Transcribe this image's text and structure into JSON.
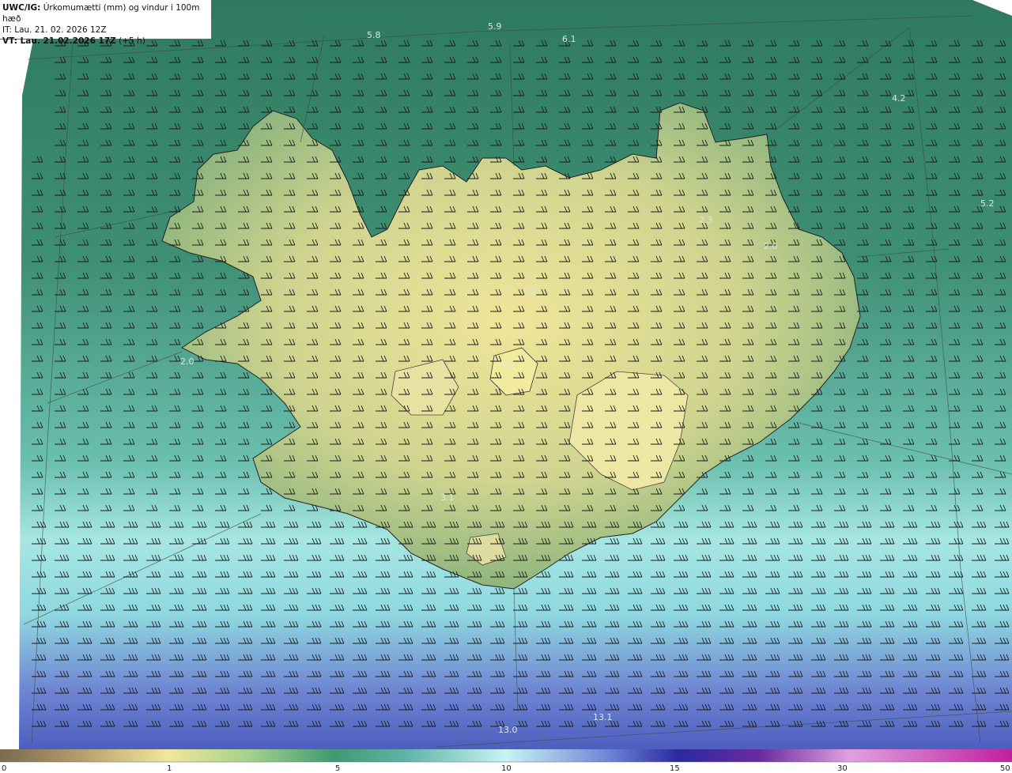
{
  "info": {
    "model": "UWC/IG:",
    "title": "Úrkomumætti (mm) og vindur i 100m hæð",
    "it_line": "IT: Lau. 21. 02. 2026 12Z",
    "vt_prefix": "VT: Lau. 21.02.2026 17Z",
    "vt_suffix": "(+5 h)"
  },
  "map_labels": [
    {
      "text": "5.8"
    },
    {
      "text": "5.9"
    },
    {
      "text": "6.1"
    },
    {
      "text": "4.2"
    },
    {
      "text": "5.2"
    },
    {
      "text": "2.3"
    },
    {
      "text": "2.0"
    },
    {
      "text": "1.2"
    },
    {
      "text": "1.0"
    },
    {
      "text": "2.0"
    },
    {
      "text": "3.1"
    },
    {
      "text": "13.1"
    },
    {
      "text": "13.0"
    }
  ],
  "colorbar": {
    "ticks": [
      "0",
      "1",
      "5",
      "10",
      "15",
      "30",
      "50"
    ],
    "stops": [
      "#7b6a4e",
      "#c9b57f",
      "#f2e89a",
      "#7fbf8a",
      "#2f7f6a",
      "#5fb3a6",
      "#bff0f0",
      "#7f9ae0",
      "#2a2aa0",
      "#7a2aa0",
      "#d080d0",
      "#c020a0"
    ]
  }
}
